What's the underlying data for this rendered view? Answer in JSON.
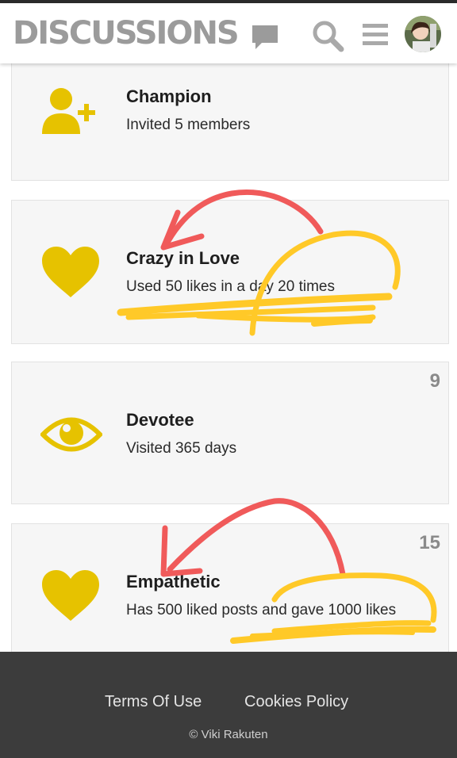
{
  "header": {
    "logo": "DISCUSSIONS"
  },
  "colors": {
    "badge_yellow": "#e6c200",
    "annotation_red": "#f05a5a",
    "annotation_yellow": "#ffc928",
    "footer_bg": "#3c3c3c"
  },
  "icons": {
    "logo_bubble": "chat-bubble-icon",
    "search": "search-icon",
    "menu": "hamburger-menu-icon"
  },
  "badges": [
    {
      "title": "Champion",
      "description": "Invited 5 members",
      "count": "",
      "icon": "add-user-icon"
    },
    {
      "title": "Crazy in Love",
      "description": "Used 50 likes in a day 20 times",
      "count": "",
      "icon": "heart-icon"
    },
    {
      "title": "Devotee",
      "description": "Visited 365 days",
      "count": "9",
      "icon": "eye-icon"
    },
    {
      "title": "Empathetic",
      "description": "Has 500 liked posts and gave 1000 likes",
      "count": "15",
      "icon": "heart-icon"
    }
  ],
  "footer": {
    "terms": "Terms Of Use",
    "cookies": "Cookies Policy",
    "copyright": "© Viki Rakuten"
  }
}
